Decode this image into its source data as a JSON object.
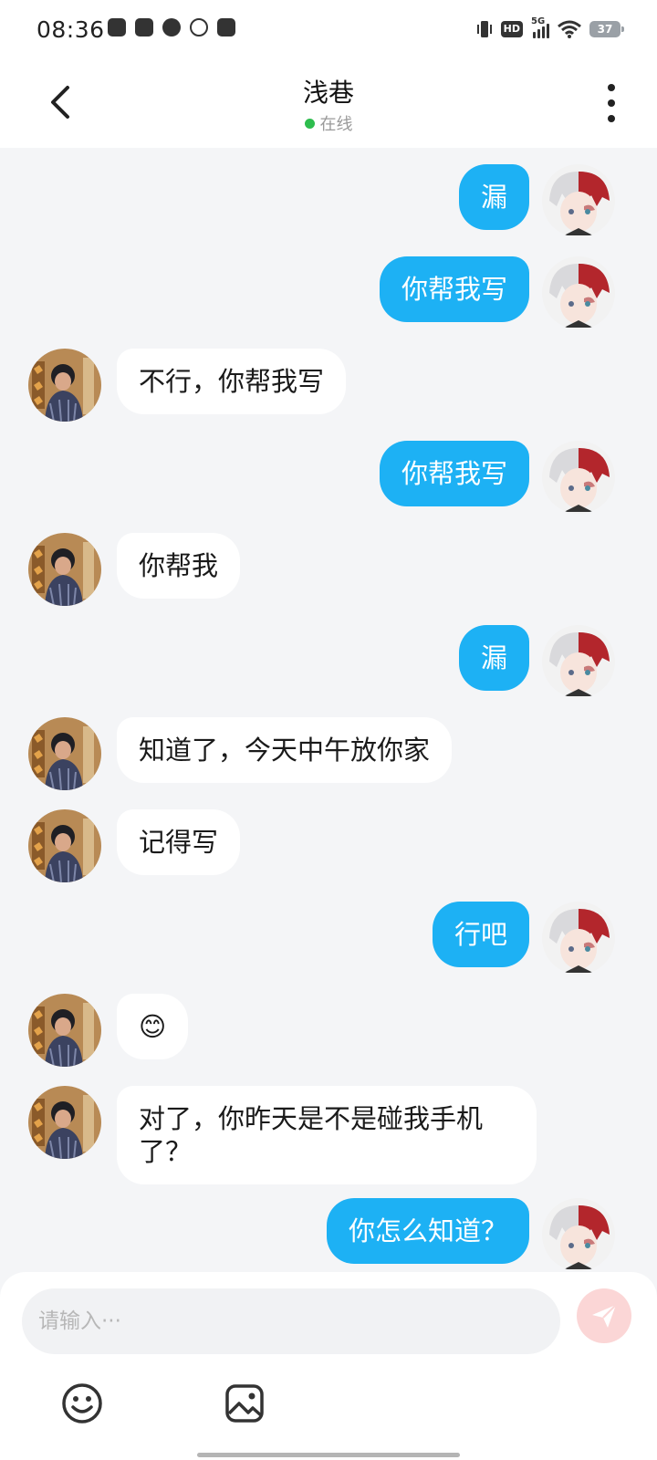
{
  "status_bar": {
    "time": "08:36",
    "network": "5G",
    "hd": "HD",
    "battery": "37"
  },
  "header": {
    "title": "浅巷",
    "status": "在线",
    "status_color": "#2ebd4e"
  },
  "messages": [
    {
      "side": "sent",
      "text": "漏"
    },
    {
      "side": "sent",
      "text": "你帮我写"
    },
    {
      "side": "received",
      "text": "不行，你帮我写"
    },
    {
      "side": "sent",
      "text": "你帮我写"
    },
    {
      "side": "received",
      "text": "你帮我"
    },
    {
      "side": "sent",
      "text": "漏"
    },
    {
      "side": "received",
      "text": "知道了，今天中午放你家"
    },
    {
      "side": "received",
      "text": "记得写"
    },
    {
      "side": "sent",
      "text": "行吧"
    },
    {
      "side": "received",
      "text": "😊"
    },
    {
      "side": "received",
      "text": "对了，你昨天是不是碰我手机了？"
    },
    {
      "side": "sent",
      "text": "你怎么知道？"
    }
  ],
  "input": {
    "placeholder": "请输入···",
    "value": ""
  },
  "icons": {
    "back": "chevron-left-icon",
    "more": "more-vertical-icon",
    "send": "paper-plane-icon",
    "emoji": "smiley-icon",
    "image": "image-icon"
  },
  "colors": {
    "sent_bubble": "#1db1f4",
    "received_bubble": "#ffffff",
    "background": "#f4f5f7",
    "send_button": "#fbd6d6"
  }
}
